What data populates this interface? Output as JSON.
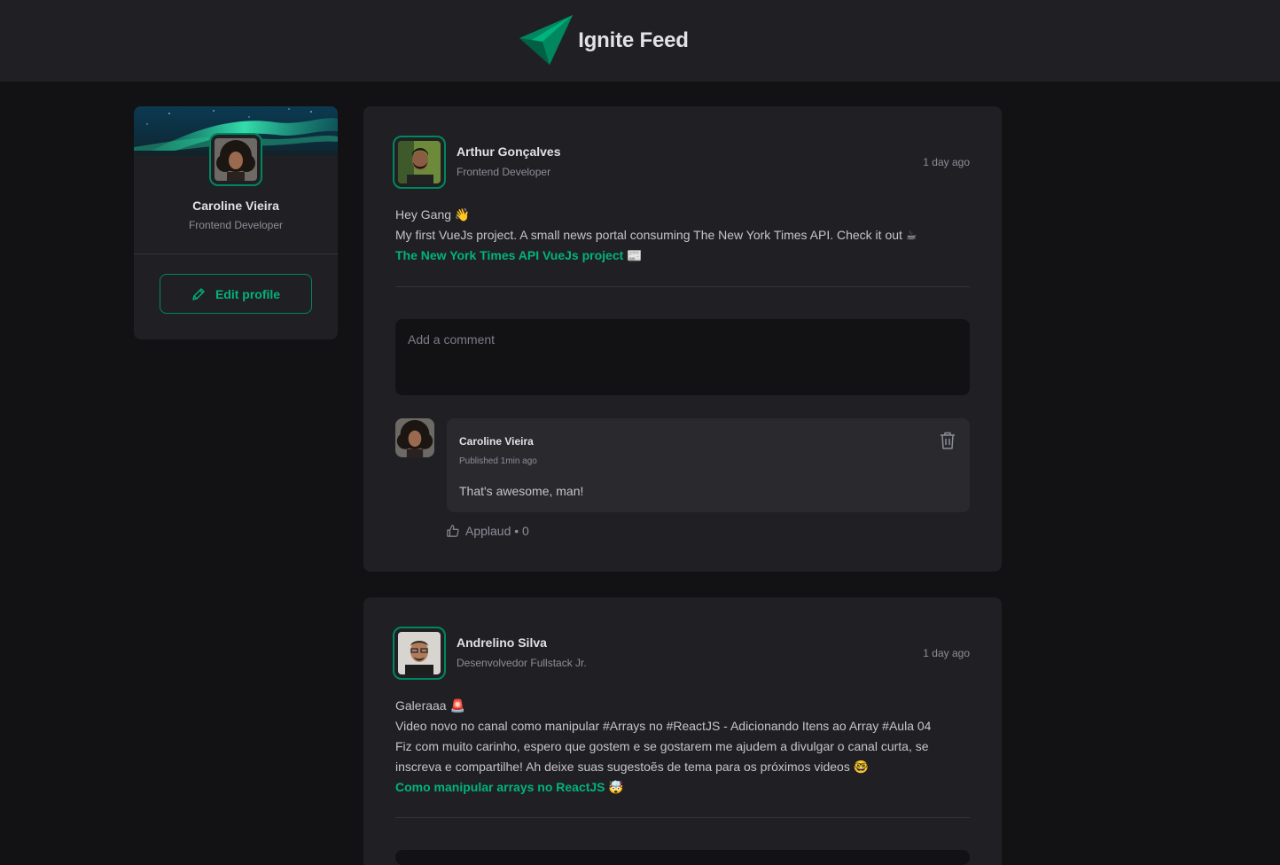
{
  "header": {
    "app_title": "Ignite Feed",
    "logo_icon": "rocket-triangle-logo"
  },
  "sidebar": {
    "name": "Caroline Vieira",
    "role": "Frontend Developer",
    "edit_label": "Edit profile"
  },
  "posts": [
    {
      "author": "Arthur Gonçalves",
      "role": "Frontend Developer",
      "time": "1 day ago",
      "lines": [
        "Hey Gang 👋",
        "My first VueJs project. A small news portal consuming The New York Times API. Check it out ☕"
      ],
      "link": "The New York Times API VueJs project 📰",
      "comment_placeholder": "Add a comment",
      "comments": [
        {
          "author": "Caroline Vieira",
          "meta": "Published 1min ago",
          "text": "That's awesome, man!",
          "applaud_label": "Applaud • 0"
        }
      ]
    },
    {
      "author": "Andrelino Silva",
      "role": "Desenvolvedor Fullstack Jr.",
      "time": "1 day ago",
      "lines": [
        "Galeraaa 🚨",
        "Video novo no canal como manipular #Arrays no #ReactJS - Adicionando Itens ao Array #Aula 04",
        "Fiz com muito carinho, espero que gostem e se gostarem me ajudem a divulgar o canal curta, se",
        "inscreva e compartilhe! Ah deixe suas sugestoẽs de tema para os próximos videos 🤓"
      ],
      "link": "Como manipular arrays no ReactJS 🤯"
    }
  ],
  "colors": {
    "background": "#121214",
    "surface": "#202024",
    "accent": "#00b37e",
    "accent_border": "#00875f"
  }
}
